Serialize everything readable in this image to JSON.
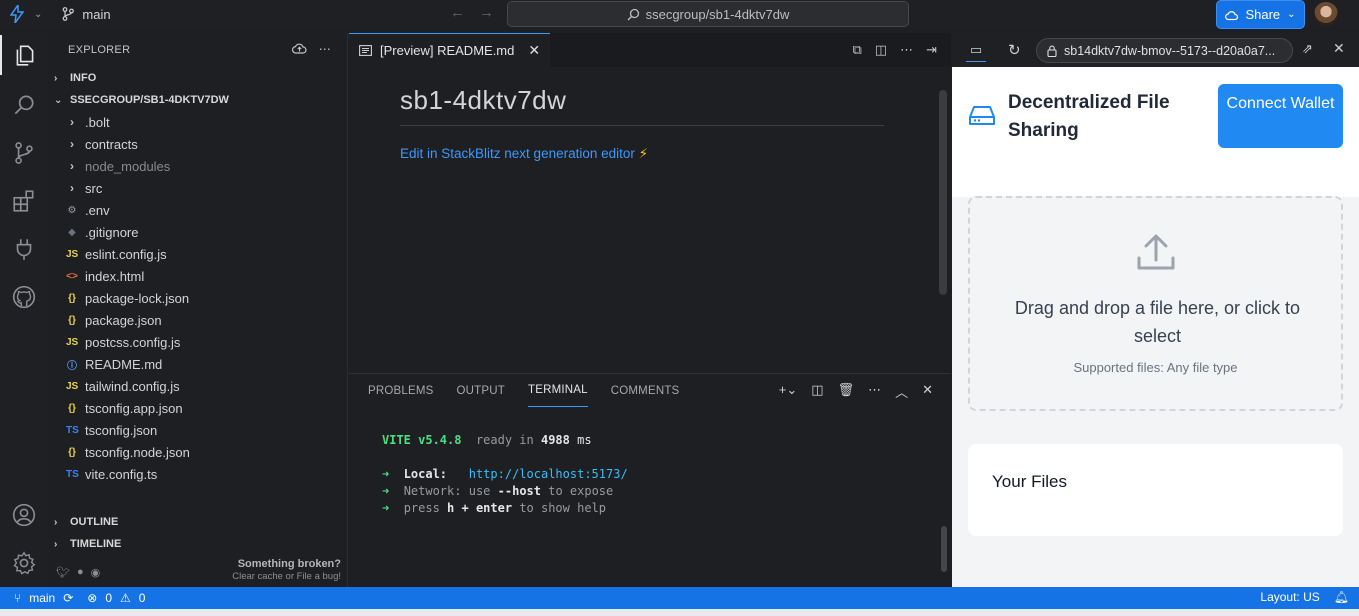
{
  "topbar": {
    "branch": "main",
    "search": "ssecgroup/sb1-4dktv7dw",
    "share_label": "Share"
  },
  "explorer": {
    "title": "EXPLORER",
    "sections": {
      "info": "INFO",
      "project": "SSECGROUP/SB1-4DKTV7DW",
      "outline": "OUTLINE",
      "timeline": "TIMELINE"
    },
    "items": [
      {
        "name": ".bolt",
        "type": "folder",
        "icon": "›"
      },
      {
        "name": "contracts",
        "type": "folder",
        "icon": "›"
      },
      {
        "name": "node_modules",
        "type": "folder",
        "icon": "›"
      },
      {
        "name": "src",
        "type": "folder",
        "icon": "›"
      },
      {
        "name": ".env",
        "type": "env",
        "icon": "⚙"
      },
      {
        "name": ".gitignore",
        "type": "git",
        "icon": "◆"
      },
      {
        "name": "eslint.config.js",
        "type": "js",
        "icon": "JS"
      },
      {
        "name": "index.html",
        "type": "html",
        "icon": "<>"
      },
      {
        "name": "package-lock.json",
        "type": "json",
        "icon": "{}"
      },
      {
        "name": "package.json",
        "type": "json",
        "icon": "{}"
      },
      {
        "name": "postcss.config.js",
        "type": "js",
        "icon": "JS"
      },
      {
        "name": "README.md",
        "type": "info",
        "icon": "ⓘ"
      },
      {
        "name": "tailwind.config.js",
        "type": "js",
        "icon": "JS"
      },
      {
        "name": "tsconfig.app.json",
        "type": "json",
        "icon": "{}"
      },
      {
        "name": "tsconfig.json",
        "type": "ts",
        "icon": "TS"
      },
      {
        "name": "tsconfig.node.json",
        "type": "json",
        "icon": "{}"
      },
      {
        "name": "vite.config.ts",
        "type": "ts",
        "icon": "TS"
      }
    ],
    "broken_title": "Something broken?",
    "broken_sub": "Clear cache or File a bug!"
  },
  "editor": {
    "tab_label": "[Preview] README.md",
    "heading": "sb1-4dktv7dw",
    "link_text": "Edit in StackBlitz next generation editor",
    "link_emoji": "⚡"
  },
  "panel": {
    "tabs": [
      "PROBLEMS",
      "OUTPUT",
      "TERMINAL",
      "COMMENTS"
    ],
    "active_tab": "TERMINAL",
    "terminal": {
      "vite": "VITE v5.4.8",
      "ready": "ready in",
      "ready_ms": "4988",
      "ms": "ms",
      "local_label": "Local:",
      "local_url": "http://localhost:5173/",
      "network_label": "Network:",
      "network_use": "use",
      "network_flag": "--host",
      "network_tail": "to expose",
      "help_press": "press",
      "help_keys": "h + enter",
      "help_tail": "to show help"
    }
  },
  "preview": {
    "url": "sb14dktv7dw-bmov--5173--d20a0a7...",
    "app_title": "Decentralized File Sharing",
    "connect_label": "Connect Wallet",
    "drop_text": "Drag and drop a file here, or click to select",
    "supported": "Supported files: Any file type",
    "files_title": "Your Files"
  },
  "statusbar": {
    "branch": "main",
    "errors": "0",
    "warnings": "0",
    "layout": "Layout: US"
  },
  "colors": {
    "accent": "#1673e6",
    "connect": "#2089f2",
    "vite_green": "#4ade80"
  }
}
